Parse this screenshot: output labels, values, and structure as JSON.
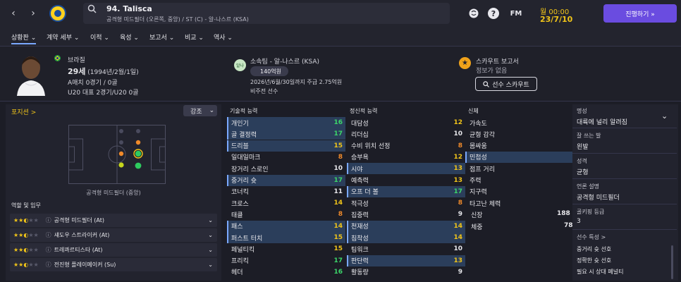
{
  "topbar": {
    "back_icon": "chevron-left-icon",
    "forward_icon": "chevron-right-icon",
    "player_name": "94. Talisca",
    "player_subtitle": "공격형 미드필더 (오른쪽, 중앙) / ST (C) - 알-나스르 (KSA)",
    "time": "월 00:00",
    "date": "23/7/10",
    "help_label": "?",
    "fm_label": "FM",
    "continue_label": "진행하기 »"
  },
  "tabs": [
    {
      "label": "상황판 ⌄"
    },
    {
      "label": "계약 세부 ⌄"
    },
    {
      "label": "이적 ⌄"
    },
    {
      "label": "육성 ⌄"
    },
    {
      "label": "보고서 ⌄"
    },
    {
      "label": "비교 ⌄"
    },
    {
      "label": "역사 ⌄"
    }
  ],
  "header": {
    "nation": "브라질",
    "age": "29세",
    "birth": " (1994년/2월/1일)",
    "a_caps": "A매치 0경기 / 0골",
    "u20_caps": "U20 대표 2경기/U20 0골",
    "club": "소속팀 - 알-나스르 (KSA)",
    "value": "140억원",
    "contract": "2026년/6월/30일까지 주급 2.75억원",
    "squad_status": "비주전 선수",
    "scout_report_title": "스카우트 보고서",
    "scout_report_status": "정보가 없음",
    "scout_button": "선수 스카우트",
    "club_badge_text": "알나"
  },
  "position_panel": {
    "title": "포지션 >",
    "dropdown": "강조",
    "position_label": "공격형 미드필더 (중앙)",
    "roles_title": "역할 및 임무",
    "roles": [
      {
        "name": "공격형 미드필더 (At)",
        "stars": 2.5
      },
      {
        "name": "섀도우 스트라이커 (At)",
        "stars": 2.5
      },
      {
        "name": "트레콰르티스타 (At)",
        "stars": 2.5
      },
      {
        "name": "전진형 플레이메이커 (Su)",
        "stars": 2.5
      }
    ]
  },
  "technical": {
    "title": "기술적 능력",
    "rows": [
      {
        "name": "개인기",
        "value": "16",
        "hl": true
      },
      {
        "name": "골 결정력",
        "value": "17",
        "hl": true
      },
      {
        "name": "드리블",
        "value": "15",
        "hl": true
      },
      {
        "name": "일대일마크",
        "value": "8",
        "hl": false
      },
      {
        "name": "장거리 스로인",
        "value": "10",
        "hl": false
      },
      {
        "name": "중거리 슛",
        "value": "17",
        "hl": true
      },
      {
        "name": "코너킥",
        "value": "11",
        "hl": false
      },
      {
        "name": "크로스",
        "value": "14",
        "hl": false
      },
      {
        "name": "태클",
        "value": "8",
        "hl": false
      },
      {
        "name": "패스",
        "value": "14",
        "hl": true
      },
      {
        "name": "퍼스트 터치",
        "value": "15",
        "hl": true
      },
      {
        "name": "페널티킥",
        "value": "15",
        "hl": false
      },
      {
        "name": "프리킥",
        "value": "17",
        "hl": false
      },
      {
        "name": "헤더",
        "value": "16",
        "hl": false
      }
    ]
  },
  "mental": {
    "title": "정신적 능력",
    "rows": [
      {
        "name": "대담성",
        "value": "12",
        "hl": false
      },
      {
        "name": "리더십",
        "value": "10",
        "hl": false
      },
      {
        "name": "수비 위치 선정",
        "value": "8",
        "hl": false
      },
      {
        "name": "승부욕",
        "value": "12",
        "hl": false
      },
      {
        "name": "시야",
        "value": "13",
        "hl": true
      },
      {
        "name": "예측력",
        "value": "13",
        "hl": false
      },
      {
        "name": "오프 더 볼",
        "value": "17",
        "hl": true
      },
      {
        "name": "적극성",
        "value": "8",
        "hl": false
      },
      {
        "name": "집중력",
        "value": "9",
        "hl": false
      },
      {
        "name": "천재성",
        "value": "14",
        "hl": true
      },
      {
        "name": "침착성",
        "value": "14",
        "hl": true
      },
      {
        "name": "팀워크",
        "value": "10",
        "hl": false
      },
      {
        "name": "판단력",
        "value": "13",
        "hl": true
      },
      {
        "name": "활동량",
        "value": "9",
        "hl": false
      }
    ]
  },
  "physical": {
    "title": "신체",
    "rows": [
      {
        "name": "가속도",
        "value": "12",
        "hl": false
      },
      {
        "name": "균형 감각",
        "value": "15",
        "hl": false
      },
      {
        "name": "몸싸움",
        "value": "15",
        "hl": false
      },
      {
        "name": "민첩성",
        "value": "13",
        "hl": true
      },
      {
        "name": "점프 거리",
        "value": "15",
        "hl": false
      },
      {
        "name": "주력",
        "value": "14",
        "hl": false
      },
      {
        "name": "지구력",
        "value": "13",
        "hl": false
      },
      {
        "name": "타고난 체력",
        "value": "15",
        "hl": false
      }
    ],
    "height_label": "신장",
    "height": "188 cm",
    "weight_label": "체중",
    "weight": "78 kg"
  },
  "info": {
    "fame_label": "명성",
    "fame": "대륙에 널리 알려짐",
    "foot_label": "잘 쓰는 발",
    "foot": "왼발",
    "personality_label": "성격",
    "personality": "균형",
    "media_label": "언론 설명",
    "media": "공격형 미드필더",
    "gk_label": "골키핑 등급",
    "gk": "3",
    "traits_label": "선수 특성 >",
    "traits": [
      "중거리 슛 선호",
      "정확한 슛 선호",
      "필요 시 상대 페널티"
    ]
  }
}
